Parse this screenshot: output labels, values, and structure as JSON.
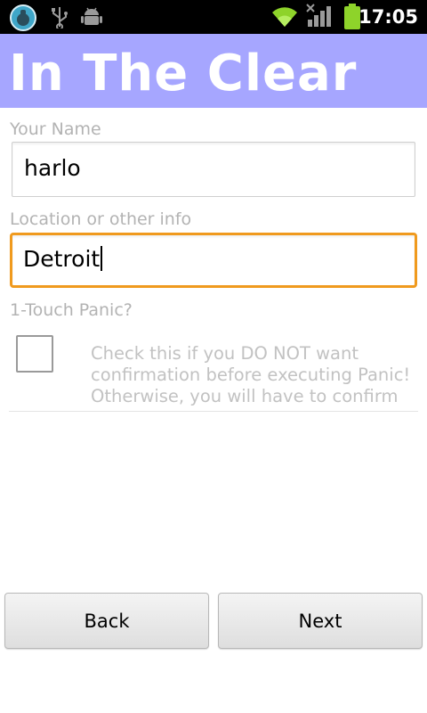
{
  "status_bar": {
    "time": "17:05",
    "icons": [
      "app-notification-icon",
      "usb-icon",
      "android-debug-icon",
      "wifi-icon",
      "signal-icon",
      "battery-icon"
    ],
    "battery_color": "#8ed32a",
    "wifi_color": "#8ed32a"
  },
  "app": {
    "title": "In The Clear",
    "title_bar_color": "#a6a6ff"
  },
  "form": {
    "name_label": "Your Name",
    "name_value": "harlo",
    "location_label": "Location or other info",
    "location_value": "Detroit",
    "panic_label": "1-Touch Panic?",
    "panic_checked": false,
    "panic_hint": "Check this if you DO NOT want confirmation before executing Panic! Otherwise, you will have to confirm"
  },
  "buttons": {
    "back_label": "Back",
    "next_label": "Next"
  }
}
